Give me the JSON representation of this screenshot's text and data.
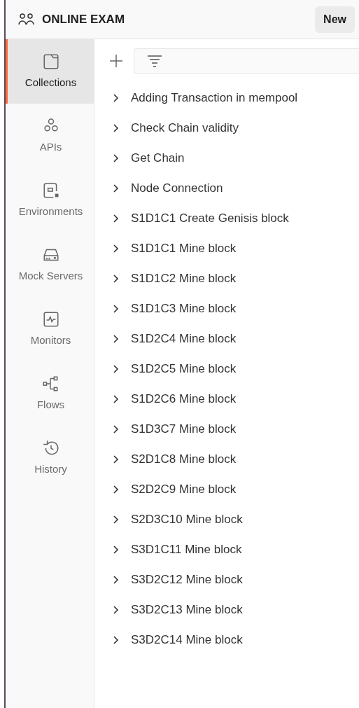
{
  "workspace": {
    "title": "ONLINE EXAM",
    "new_button": "New"
  },
  "sidebar": {
    "items": [
      {
        "kind": "collections",
        "label": "Collections",
        "selected": true
      },
      {
        "kind": "apis",
        "label": "APIs",
        "selected": false
      },
      {
        "kind": "environments",
        "label": "Environments",
        "selected": false
      },
      {
        "kind": "mock",
        "label": "Mock Servers",
        "selected": false
      },
      {
        "kind": "monitors",
        "label": "Monitors",
        "selected": false
      },
      {
        "kind": "flows",
        "label": "Flows",
        "selected": false
      },
      {
        "kind": "history",
        "label": "History",
        "selected": false
      }
    ]
  },
  "collections": [
    {
      "name": "Adding Transaction in mempool"
    },
    {
      "name": "Check Chain validity"
    },
    {
      "name": "Get Chain"
    },
    {
      "name": "Node Connection"
    },
    {
      "name": "S1D1C1 Create Genisis block"
    },
    {
      "name": "S1D1C1 Mine block"
    },
    {
      "name": "S1D1C2 Mine block"
    },
    {
      "name": "S1D1C3 Mine block"
    },
    {
      "name": "S1D2C4 Mine block"
    },
    {
      "name": "S1D2C5 Mine block"
    },
    {
      "name": "S1D2C6 Mine block"
    },
    {
      "name": "S1D3C7 Mine block"
    },
    {
      "name": "S2D1C8 Mine block"
    },
    {
      "name": "S2D2C9 Mine block"
    },
    {
      "name": "S2D3C10 Mine block"
    },
    {
      "name": "S3D1C11 Mine block"
    },
    {
      "name": "S3D2C12 Mine block"
    },
    {
      "name": "S3D2C13 Mine block"
    },
    {
      "name": "S3D2C14 Mine block"
    }
  ]
}
